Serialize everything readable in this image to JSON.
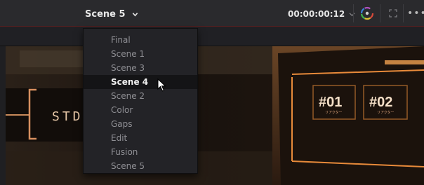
{
  "header": {
    "scene_label": "Scene 5",
    "timecode": "00:00:00:12"
  },
  "icons": {
    "scene_chevron": "chevron-down-icon",
    "timecode_chevron": "chevron-down-icon",
    "color_button": "color-wheel-icon",
    "expand_button": "expand-icon",
    "more_button": "more-icon"
  },
  "viewer": {
    "tiles": [
      "#01",
      "#02"
    ],
    "tile_subtext": [
      "リアクター",
      "リアクター"
    ],
    "sign_text": "STD"
  },
  "dropdown": {
    "items": [
      "Final",
      "Scene 1",
      "Scene 3",
      "Scene 4",
      "Scene 2",
      "Color",
      "Gaps",
      "Edit",
      "Fusion",
      "Scene 5"
    ],
    "highlighted_item": "Scene 4"
  },
  "colors": {
    "accent_line": "#5a2020",
    "neon": "#e88a3a",
    "menu_bg": "#232327",
    "menu_highlight": "#141416"
  }
}
